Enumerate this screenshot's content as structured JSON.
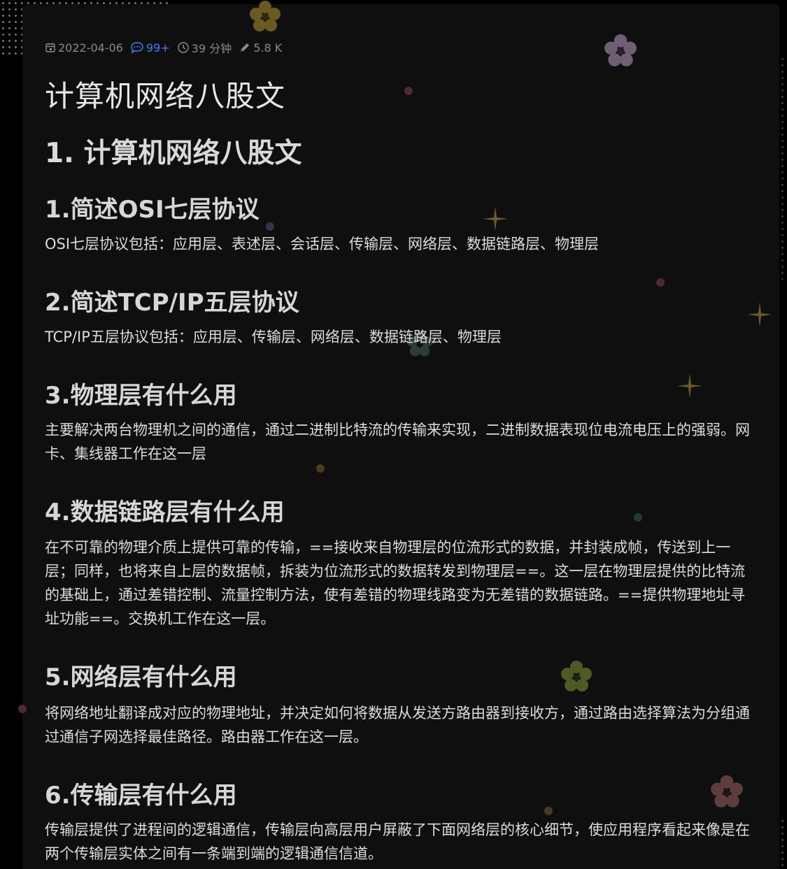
{
  "meta": {
    "date": "2022-04-06",
    "comments": "99+",
    "read_time": "39 分钟",
    "words": "5.8 K",
    "icons": [
      "calendar-icon",
      "comment-icon",
      "clock-icon",
      "pencil-icon"
    ]
  },
  "article": {
    "title": "计算机网络八股文",
    "section_heading": "1. 计算机网络八股文",
    "subsections": [
      {
        "heading": "1.简述OSI七层协议",
        "body": "OSI七层协议包括：应用层、表述层、会话层、传输层、网络层、数据链路层、物理层"
      },
      {
        "heading": "2.简述TCP/IP五层协议",
        "body": "TCP/IP五层协议包括：应用层、传输层、网络层、数据链路层、物理层"
      },
      {
        "heading": "3.物理层有什么用",
        "body": "主要解决两台物理机之间的通信，通过二进制比特流的传输来实现，二进制数据表现位电流电压上的强弱。网卡、集线器工作在这一层"
      },
      {
        "heading": "4.数据链路层有什么用",
        "body": "在不可靠的物理介质上提供可靠的传输，==接收来自物理层的位流形式的数据，并封装成帧，传送到上一层；同样，也将来自上层的数据帧，拆装为位流形式的数据转发到物理层==。这一层在物理层提供的比特流的基础上，通过差错控制、流量控制方法，使有差错的物理线路变为无差错的数据链路。==提供物理地址寻址功能==。交换机工作在这一层。"
      },
      {
        "heading": "5.网络层有什么用",
        "body": "将网络地址翻译成对应的物理地址，并决定如何将数据从发送方路由器到接收方，通过路由选择算法为分组通过通信子网选择最佳路径。路由器工作在这一层。"
      },
      {
        "heading": "6.传输层有什么用",
        "body": "传输层提供了进程间的逻辑通信，传输层向高层用户屏蔽了下面网络层的核心细节，使应用程序看起来像是在两个传输层实体之间有一条端到端的逻辑通信信道。"
      }
    ]
  },
  "colors": {
    "background": "#000000",
    "card": "#0f0f0f",
    "text": "#dcdcdc",
    "meta": "#8a8a8a",
    "accent": "#3b82f6"
  }
}
